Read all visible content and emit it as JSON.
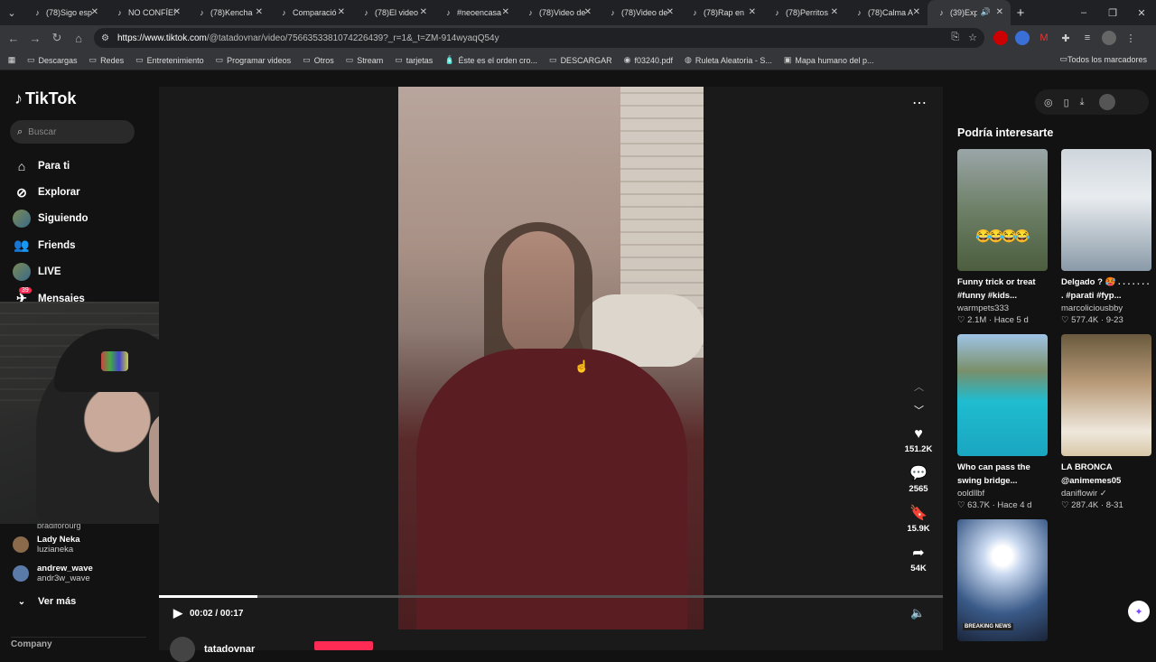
{
  "browser": {
    "tabs": [
      {
        "title": "(78)Sigo esp",
        "active": false
      },
      {
        "title": "NO CONFÍES",
        "active": false
      },
      {
        "title": "(78)Kencha",
        "active": false
      },
      {
        "title": "Comparació",
        "active": false
      },
      {
        "title": "(78)El video",
        "active": false
      },
      {
        "title": "#neoencasa",
        "active": false
      },
      {
        "title": "(78)Video de",
        "active": false
      },
      {
        "title": "(78)Video de",
        "active": false
      },
      {
        "title": "(78)Rap en",
        "active": false
      },
      {
        "title": "(78)Perritos",
        "active": false
      },
      {
        "title": "(78)Calma A",
        "active": false
      },
      {
        "title": "(39)Explo",
        "active": true
      }
    ],
    "url_host": "https://www.tiktok.com",
    "url_path": "/@tatadovnar/video/7566353381074226439?_r=1&_t=ZM-914wyaqQ54y",
    "bookmarks": [
      {
        "label": "Descargas",
        "icon": "folder-icon"
      },
      {
        "label": "Redes",
        "icon": "folder-icon"
      },
      {
        "label": "Entretenimiento",
        "icon": "folder-icon"
      },
      {
        "label": "Programar videos",
        "icon": "folder-icon"
      },
      {
        "label": "Otros",
        "icon": "folder-icon"
      },
      {
        "label": "Stream",
        "icon": "folder-icon"
      },
      {
        "label": "tarjetas",
        "icon": "folder-icon"
      },
      {
        "label": "Éste es el orden cro...",
        "icon": "bottle-icon"
      },
      {
        "label": "DESCARGAR",
        "icon": "folder-icon"
      },
      {
        "label": "f03240.pdf",
        "icon": "globe-icon"
      },
      {
        "label": "Ruleta Aleatoria - S...",
        "icon": "wheel-icon"
      },
      {
        "label": "Mapa humano del p...",
        "icon": "map-icon"
      }
    ],
    "all_bookmarks": "Todos los marcadores"
  },
  "sidebar": {
    "logo": "TikTok",
    "search_placeholder": "Buscar",
    "nav": [
      {
        "label": "Para ti",
        "icon": "home-icon"
      },
      {
        "label": "Explorar",
        "icon": "compass-icon"
      },
      {
        "label": "Siguiendo",
        "icon": "following-avatar-icon"
      },
      {
        "label": "Friends",
        "icon": "friends-icon"
      },
      {
        "label": "LIVE",
        "icon": "live-icon"
      },
      {
        "label": "Mensajes",
        "icon": "messages-icon"
      }
    ],
    "messages_badge": "39",
    "following_cut": "bradiforourg",
    "following": [
      {
        "name": "Lady Neka",
        "handle": "luzianeka"
      },
      {
        "name": "andrew_wave",
        "handle": "andr3w_wave"
      }
    ],
    "see_more": "Ver más",
    "company": "Company"
  },
  "video": {
    "author": "tatadovnar",
    "time": "00:02 / 00:17",
    "progress": 0.126,
    "likes": "151.2K",
    "comments": "2565",
    "saves": "15.9K",
    "shares": "54K"
  },
  "recommendations": {
    "title": "Podría interesarte",
    "cards": [
      {
        "title": "Funny trick or treat #funny #kids...",
        "user": "warmpets333",
        "stats": "♡ 2.1M · Hace 5 d",
        "thumb": "park"
      },
      {
        "title": "Delgado ? 🥵 . . . . . . . . #parati #fyp...",
        "user": "marcoliciousbby",
        "stats": "♡ 577.4K · 9-23",
        "thumb": "drinking"
      },
      {
        "title": "Who can pass the swing bridge...",
        "user": "ooldllbf",
        "stats": "♡ 63.7K · Hace 4 d",
        "thumb": "pool"
      },
      {
        "title": "LA BRONCA @animemes05",
        "user": "daniflowir ✓",
        "stats": "♡ 287.4K · 8-31",
        "thumb": "cartoon"
      },
      {
        "title": "",
        "user": "",
        "stats": "",
        "thumb": "rocket",
        "overlay": "BREAKING NEWS"
      }
    ]
  }
}
